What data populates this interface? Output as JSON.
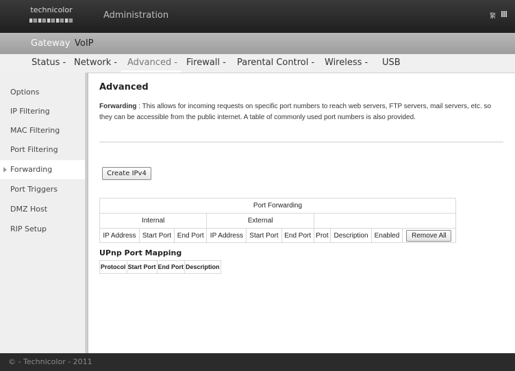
{
  "header": {
    "logo_text": "technicolor",
    "title": "Administration",
    "lang": "繁"
  },
  "top_nav": {
    "gateway": "Gateway",
    "voip": "VoIP"
  },
  "tabs": [
    "Status -",
    "Network -",
    "Advanced -",
    "Firewall -",
    "Parental Control -",
    "Wireless -",
    "USB"
  ],
  "active_tab": "Advanced -",
  "sidebar": {
    "items": [
      "Options",
      "IP Filtering",
      "MAC Filtering",
      "Port Filtering",
      "Forwarding",
      "Port Triggers",
      "DMZ Host",
      "RIP Setup"
    ],
    "active": "Forwarding"
  },
  "page": {
    "title": "Advanced",
    "desc_label": "Forwarding",
    "desc_sep": " :  ",
    "desc_text": "This allows for incoming requests on specific port numbers to reach web servers, FTP servers, mail servers, etc. so they can be accessible from the public internet. A table of commonly used port numbers is also provided.",
    "create_button": "Create IPv4"
  },
  "port_forwarding": {
    "title": "Port Forwarding",
    "internal": "Internal",
    "external": "External",
    "columns": [
      "IP Address",
      "Start Port",
      "End Port",
      "IP Address",
      "Start Port",
      "End Port",
      "Prot",
      "Description",
      "Enabled"
    ],
    "remove_all": "Remove All"
  },
  "upnp": {
    "title": "UPnp Port Mapping",
    "columns": [
      "Protocol",
      "Start Port",
      "End Port",
      "Description"
    ]
  },
  "footer": {
    "copyright": "© - Technicolor - 2011"
  }
}
